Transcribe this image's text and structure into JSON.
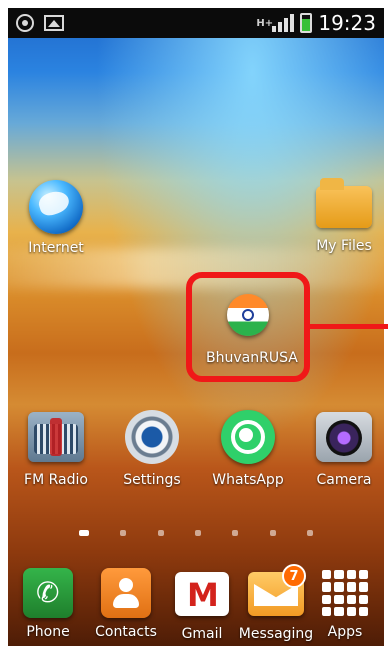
{
  "status_bar": {
    "network_type": "H+",
    "time": "19:23"
  },
  "home": {
    "row1": {
      "left_label": "Internet",
      "right_label": "My Files"
    },
    "highlight": {
      "label": "BhuvanRUSA"
    },
    "row3": {
      "labels": [
        "FM Radio",
        "Settings",
        "WhatsApp",
        "Camera"
      ]
    }
  },
  "dock": {
    "labels": [
      "Phone",
      "Contacts",
      "Gmail",
      "Messaging",
      "Apps"
    ],
    "messaging_badge": "7"
  },
  "colors": {
    "highlight_red": "#f01818",
    "statusbar_bg": "#0b0b0b"
  },
  "icons": {
    "status": [
      "gps-icon",
      "gallery-icon",
      "network-type-icon",
      "signal-strength-icon",
      "battery-icon"
    ]
  }
}
